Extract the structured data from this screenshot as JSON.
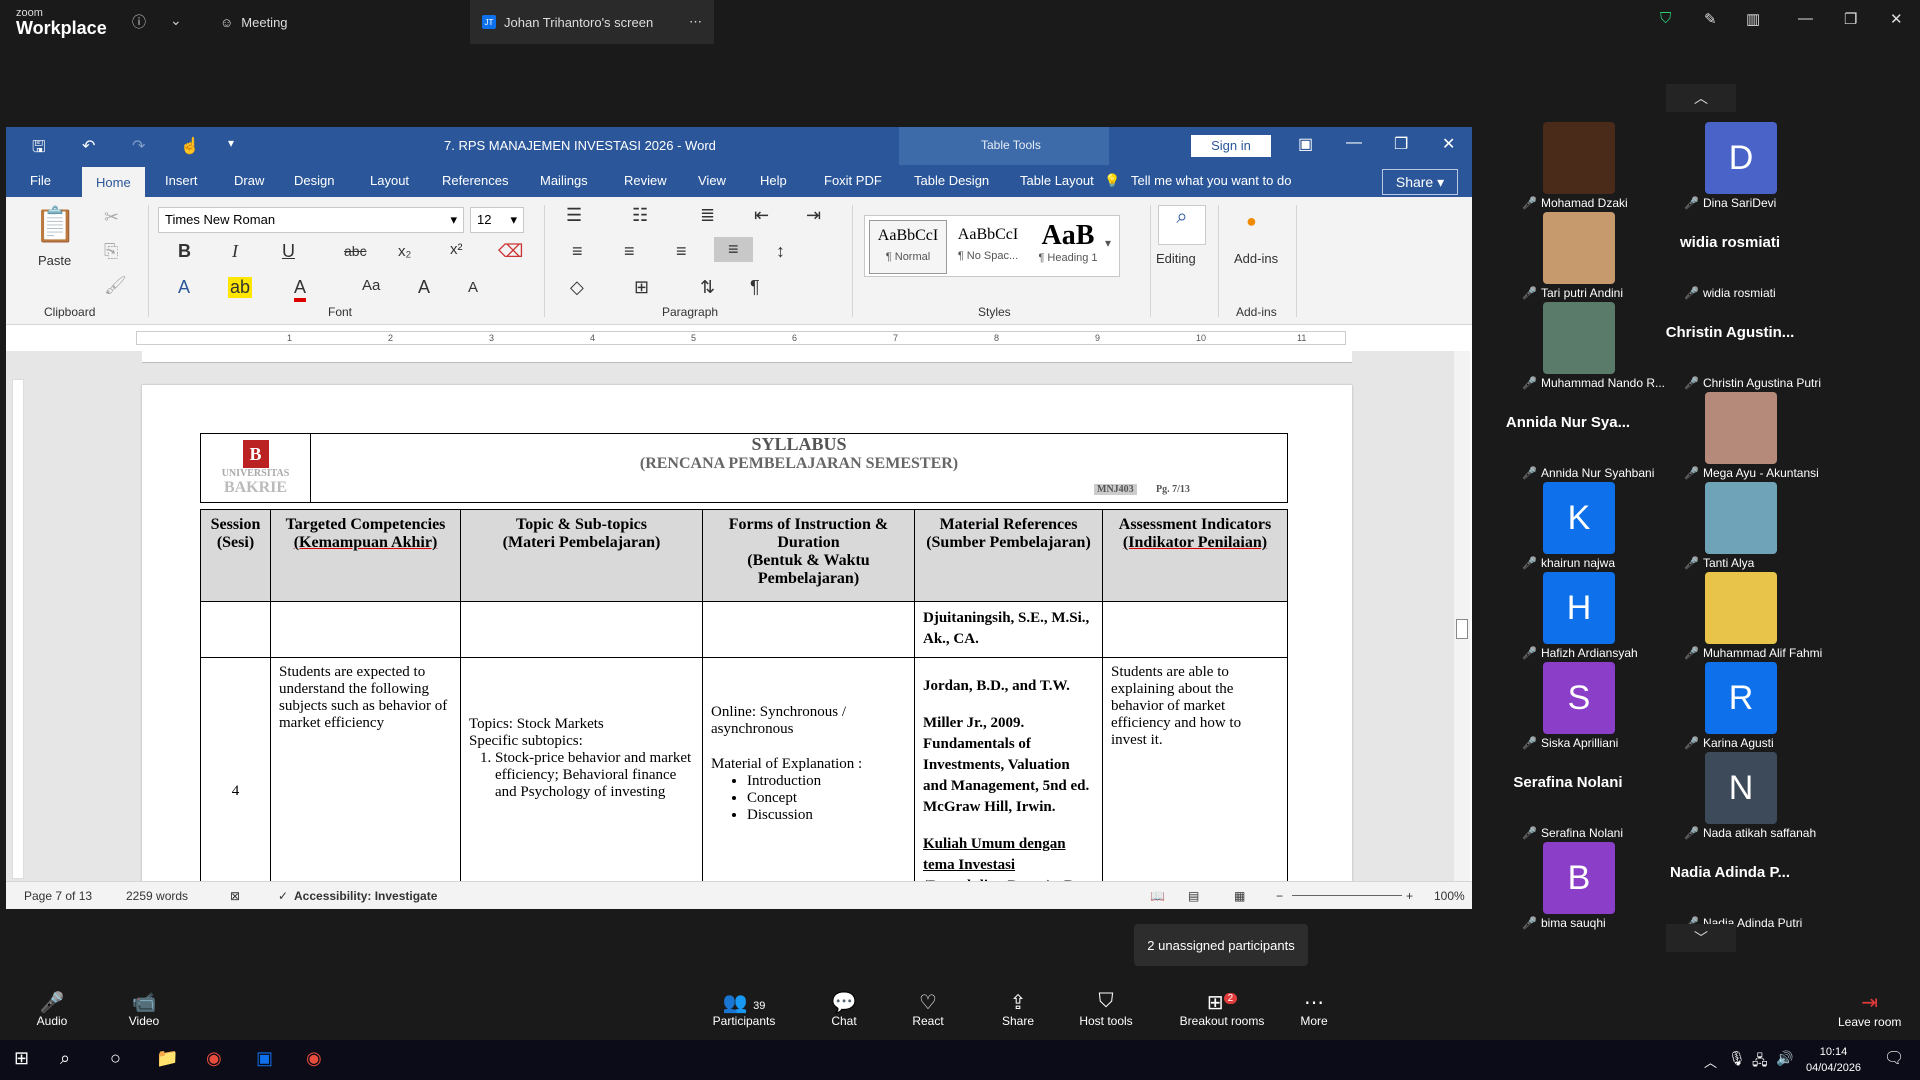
{
  "zoom": {
    "brand_small": "zoom",
    "brand": "Workplace",
    "tabs": [
      "Meeting",
      "Johan Trihantoro's screen"
    ]
  },
  "word": {
    "title": "7. RPS MANAJEMEN INVESTASI 2026 - Word",
    "table_tools": "Table Tools",
    "sign_in": "Sign in",
    "menu": [
      "File",
      "Home",
      "Insert",
      "Draw",
      "Design",
      "Layout",
      "References",
      "Mailings",
      "Review",
      "View",
      "Help",
      "Foxit PDF",
      "Table Design",
      "Table Layout"
    ],
    "tell_me": "Tell me what you want to do",
    "share": "Share",
    "font_name": "Times New Roman",
    "font_size": "12",
    "groups": [
      "Clipboard",
      "Font",
      "Paragraph",
      "Styles",
      "Add-ins"
    ],
    "paste": "Paste",
    "editing": "Editing",
    "addins": "Add-ins",
    "styles": [
      {
        "preview": "AaBbCcI",
        "name": "¶ Normal"
      },
      {
        "preview": "AaBbCcI",
        "name": "¶ No Spac..."
      },
      {
        "preview": "AaB",
        "name": "¶ Heading 1"
      }
    ],
    "status": {
      "page": "Page 7 of 13",
      "words": "2259 words",
      "accessibility": "Accessibility: Investigate",
      "zoom": "100%"
    }
  },
  "doc": {
    "header": {
      "logo_u": "UNIVERSITAS",
      "logo_b": "BAKRIE",
      "title": "SYLLABUS",
      "subtitle": "(RENCANA PEMBELAJARAN SEMESTER)",
      "code": "MNJ403",
      "page": "Pg. 7/13"
    },
    "columns": [
      {
        "en": "Session",
        "id": "(Sesi)"
      },
      {
        "en": "Targeted Competencies",
        "id": "(Kemampuan Akhir)"
      },
      {
        "en": "Topic & Sub-topics",
        "id": "(Materi Pembelajaran)"
      },
      {
        "en": "Forms of Instruction & Duration",
        "id": "(Bentuk & Waktu Pembelajaran)"
      },
      {
        "en": "Material References",
        "id": "(Sumber Pembelajaran)"
      },
      {
        "en": "Assessment Indicators",
        "id": "(Indikator Penilaian)"
      }
    ],
    "row1_ref": "Djuitaningsih, S.E., M.Si., Ak., CA.",
    "row2": {
      "session": "4",
      "competency": "Students are expected to understand the following subjects such as behavior of market efficiency",
      "topics_title": "Topics: Stock Markets",
      "subtopics_title": "Specific subtopics:",
      "subtopic": "Stock-price behavior and market efficiency; Behavioral finance and Psychology of investing",
      "online": "Online: Synchronous / asynchronous",
      "material_of": "Material of Explanation :",
      "bullets": [
        "Introduction",
        "Concept",
        "Discussion"
      ],
      "ref1": "Jordan, B.D., and T.W.",
      "ref2": "Miller Jr., 2009. Fundamentals of Investments, Valuation and Management, 5nd ed. McGraw Hill, Irwin.",
      "ref3": "Kuliah Umum dengan tema Investasi (Pengabdian Dosen) - Dr. Tita",
      "assessment": "Students are able to explaining about the behavior of market efficiency and how to invest it."
    }
  },
  "participants": [
    {
      "name": "Mohamad Dzaki",
      "kind": "photo",
      "color": "#4a2a18"
    },
    {
      "name": "Dina SariDevi",
      "kind": "letter",
      "letter": "D",
      "color": "#4a63c9"
    },
    {
      "name": "Tari putri Andini",
      "kind": "photo",
      "color": "#c79a6e"
    },
    {
      "name": "widia rosmiati",
      "kind": "text",
      "display": "widia rosmiati"
    },
    {
      "name": "Muhammad Nando R...",
      "kind": "photo",
      "color": "#5a7a6a"
    },
    {
      "name": "Christin Agustina Putri",
      "kind": "text",
      "display": "Christin Agustin..."
    },
    {
      "name": "Annida Nur Syahbani",
      "kind": "text",
      "display": "Annida Nur Sya..."
    },
    {
      "name": "Mega Ayu - Akuntansi",
      "kind": "photo",
      "color": "#b68a7a"
    },
    {
      "name": "khairun najwa",
      "kind": "letter",
      "letter": "K",
      "color": "#0e71eb"
    },
    {
      "name": "Tanti Alya",
      "kind": "photo",
      "color": "#6fa4b8"
    },
    {
      "name": "Hafizh Ardiansyah",
      "kind": "letter",
      "letter": "H",
      "color": "#0e71eb"
    },
    {
      "name": "Muhammad Alif Fahmi",
      "kind": "photo",
      "color": "#e8c44a"
    },
    {
      "name": "Siska Aprilliani",
      "kind": "letter",
      "letter": "S",
      "color": "#8b3fc9"
    },
    {
      "name": "Karina Agusti",
      "kind": "letter",
      "letter": "R",
      "color": "#0e71eb"
    },
    {
      "name": "Serafina Nolani",
      "kind": "text",
      "display": "Serafina Nolani"
    },
    {
      "name": "Nada atikah saffanah",
      "kind": "letter",
      "letter": "N",
      "color": "#3d4a5a"
    },
    {
      "name": "bima sauqhi",
      "kind": "letter",
      "letter": "B",
      "color": "#8b3fc9"
    },
    {
      "name": "Nadia Adinda Putri",
      "kind": "text",
      "display": "Nadia Adinda P..."
    }
  ],
  "toast": "2 unassigned participants",
  "controls": {
    "audio": "Audio",
    "video": "Video",
    "participants": "Participants",
    "participants_count": "39",
    "chat": "Chat",
    "react": "React",
    "share": "Share",
    "host_tools": "Host tools",
    "breakout": "Breakout rooms",
    "breakout_badge": "2",
    "more": "More",
    "leave": "Leave room"
  },
  "clock": {
    "time": "10:14",
    "date": "04/04/2026"
  }
}
